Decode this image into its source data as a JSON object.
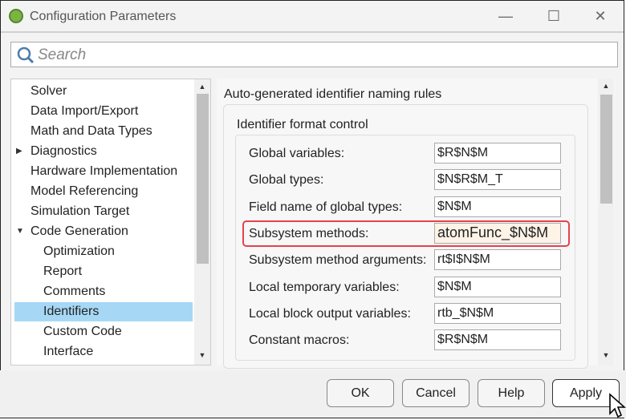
{
  "window": {
    "title": "Configuration Parameters"
  },
  "search": {
    "placeholder": "Search"
  },
  "tree": {
    "items": [
      {
        "label": "Solver"
      },
      {
        "label": "Data Import/Export"
      },
      {
        "label": "Math and Data Types"
      },
      {
        "label": "Diagnostics",
        "expander": "collapsed"
      },
      {
        "label": "Hardware Implementation"
      },
      {
        "label": "Model Referencing"
      },
      {
        "label": "Simulation Target"
      },
      {
        "label": "Code Generation",
        "expander": "expanded"
      },
      {
        "label": "Optimization"
      },
      {
        "label": "Report"
      },
      {
        "label": "Comments"
      },
      {
        "label": "Identifiers",
        "selected": true
      },
      {
        "label": "Custom Code"
      },
      {
        "label": "Interface"
      }
    ]
  },
  "panel": {
    "section_title": "Auto-generated identifier naming rules",
    "group_title": "Identifier format control",
    "rows": [
      {
        "label": "Global variables:",
        "value": "$R$N$M"
      },
      {
        "label": "Global types:",
        "value": "$N$R$M_T"
      },
      {
        "label": "Field name of global types:",
        "value": "$N$M"
      },
      {
        "label": "Subsystem methods:",
        "value": "atomFunc_$N$M",
        "highlighted": true
      },
      {
        "label": "Subsystem method arguments:",
        "value": "rt$I$N$M"
      },
      {
        "label": "Local temporary variables:",
        "value": "$N$M"
      },
      {
        "label": "Local block output variables:",
        "value": "rtb_$N$M"
      },
      {
        "label": "Constant macros:",
        "value": "$R$N$M"
      }
    ]
  },
  "buttons": {
    "ok": "OK",
    "cancel": "Cancel",
    "help": "Help",
    "apply": "Apply"
  },
  "colors": {
    "selection": "#a6d8f5",
    "highlight": "#e4434b",
    "modified_field": "#fdf3e7"
  }
}
